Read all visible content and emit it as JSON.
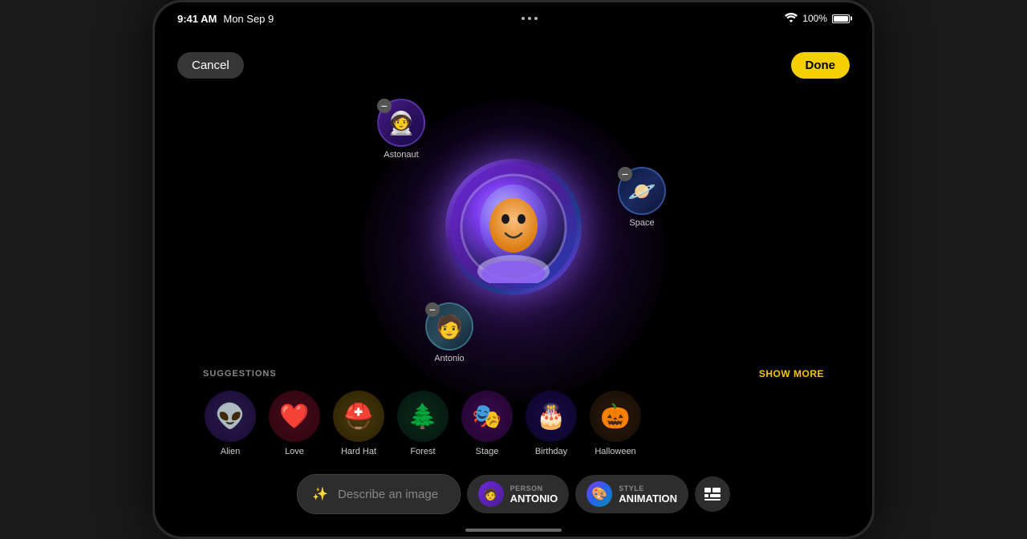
{
  "status_bar": {
    "time": "9:41 AM",
    "date": "Mon Sep 9",
    "battery_percent": "100%"
  },
  "header": {
    "cancel_label": "Cancel",
    "done_label": "Done"
  },
  "avatars": {
    "main_label": "Astronaut",
    "float_items": [
      {
        "id": "astronaut",
        "label": "Astonaut",
        "emoji": "🧑‍🚀"
      },
      {
        "id": "space",
        "label": "Space",
        "emoji": "🪐"
      },
      {
        "id": "antonio",
        "label": "Antonio",
        "emoji": "👨"
      }
    ]
  },
  "suggestions": {
    "section_label": "SUGGESTIONS",
    "show_more_label": "SHOW MORE",
    "items": [
      {
        "id": "alien",
        "label": "Alien",
        "emoji": "👽"
      },
      {
        "id": "love",
        "label": "Love",
        "emoji": "❤️"
      },
      {
        "id": "hardhat",
        "label": "Hard Hat",
        "emoji": "⛑️"
      },
      {
        "id": "forest",
        "label": "Forest",
        "emoji": "🌲"
      },
      {
        "id": "stage",
        "label": "Stage",
        "emoji": "🎭"
      },
      {
        "id": "birthday",
        "label": "Birthday",
        "emoji": "🎂"
      },
      {
        "id": "halloween",
        "label": "Halloween",
        "emoji": "🎃"
      }
    ]
  },
  "toolbar": {
    "describe_placeholder": "Describe an image",
    "person_label": "PERSON",
    "person_name": "ANTONIO",
    "style_label": "STYLE",
    "style_name": "ANIMATION"
  }
}
